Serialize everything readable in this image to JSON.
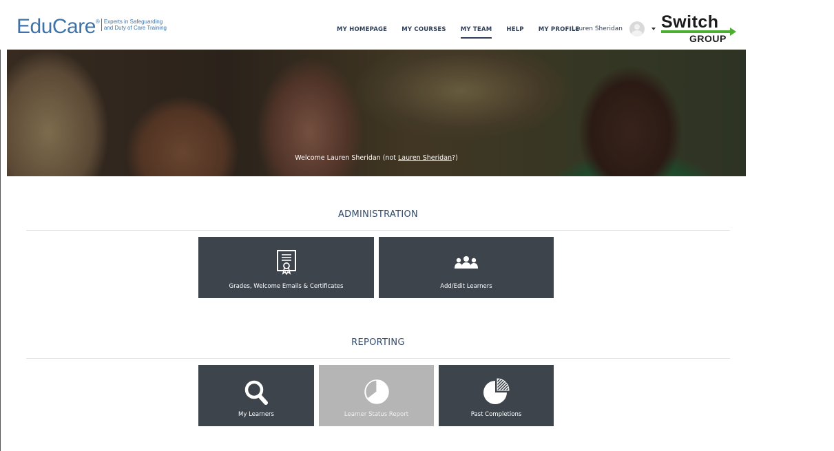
{
  "header": {
    "logo": {
      "word": "EduCare",
      "reg": "®",
      "tag_line1": "Experts in Safeguarding",
      "tag_line2": "and Duty of Care Training"
    },
    "nav": [
      {
        "label": "MY HOMEPAGE",
        "active": false
      },
      {
        "label": "MY COURSES",
        "active": false
      },
      {
        "label": "MY TEAM",
        "active": true
      },
      {
        "label": "HELP",
        "active": false
      },
      {
        "label": "MY PROFILE",
        "active": false
      }
    ],
    "user_name": "Lauren Sheridan",
    "partner_logo": {
      "word": "Switch",
      "sub": "GROUP"
    }
  },
  "hero": {
    "welcome_prefix": "Welcome Lauren Sheridan (not ",
    "welcome_link": "Lauren Sheridan",
    "welcome_suffix": "?)"
  },
  "administration": {
    "title": "ADMINISTRATION",
    "tiles": [
      {
        "label": "Grades, Welcome Emails & Certificates",
        "icon": "certificate-icon"
      },
      {
        "label": "Add/Edit Learners",
        "icon": "users-icon"
      }
    ]
  },
  "reporting": {
    "title": "REPORTING",
    "tiles": [
      {
        "label": "My Learners",
        "icon": "search-icon",
        "disabled": false
      },
      {
        "label": "Learner Status Report",
        "icon": "pie-chart-icon",
        "disabled": true
      },
      {
        "label": "Past Completions",
        "icon": "pie-chart-hatched-icon",
        "disabled": false
      }
    ]
  },
  "colors": {
    "tile": "#3e444c",
    "tile_disabled": "#b5b5b5",
    "heading": "#2f4868",
    "brand_blue": "#3f73a8",
    "switch_green": "#4caf32"
  }
}
